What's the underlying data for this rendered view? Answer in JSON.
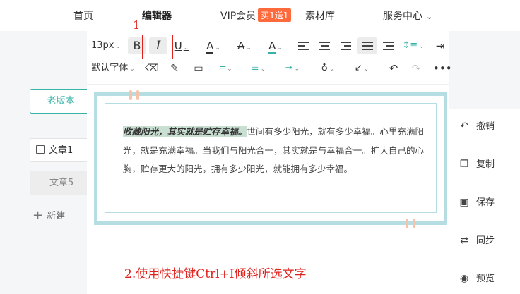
{
  "topnav": {
    "home": "首页",
    "editor": "编辑器",
    "vip": "VIP会员",
    "vip_badge": "买1送1",
    "materials": "素材库",
    "service": "服务中心"
  },
  "sidebar": {
    "old_version": "老版本",
    "docs": [
      {
        "label": "文章1"
      },
      {
        "label": "文章5"
      }
    ],
    "new_label": "新建"
  },
  "toolbar": {
    "font_size": "13px",
    "default_font": "默认字体",
    "bold_glyph": "B",
    "italic_glyph": "I",
    "underline_glyph": "U",
    "font_color_glyph": "A",
    "strike_glyph": "A",
    "highlight_glyph": "A"
  },
  "markers": {
    "step1": "1",
    "step2": "2.使用快捷键Ctrl+I倾斜所选文字"
  },
  "content": {
    "highlighted": "收藏阳光，其实就是贮存幸福。",
    "rest": "世间有多少阳光，就有多少幸福。心里充满阳光，就是充满幸福。当我们与阳光合一，其实就是与幸福合一。扩大自己的心胸，贮存更大的阳光，拥有多少阳光，就能拥有多少幸福。"
  },
  "right_panel": {
    "undo": "撤销",
    "copy": "复制",
    "save": "保存",
    "sync": "同步",
    "preview": "预览"
  }
}
